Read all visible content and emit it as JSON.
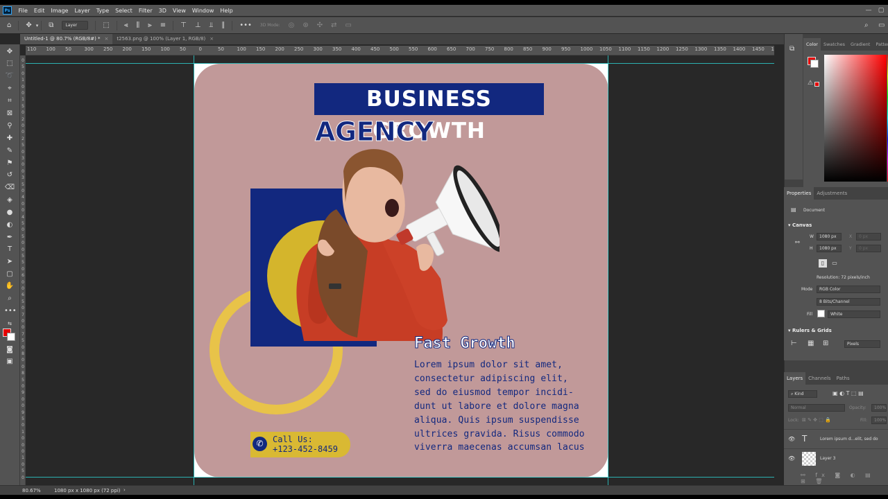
{
  "app": {
    "logo": "Ps"
  },
  "menubar": {
    "items": [
      "File",
      "Edit",
      "Image",
      "Layer",
      "Type",
      "Select",
      "Filter",
      "3D",
      "View",
      "Window",
      "Help"
    ]
  },
  "options_bar": {
    "layer_select": "Layer",
    "mode_3d": "3D Mode:"
  },
  "tabs": [
    {
      "label": "Untitled-1 @ 80.7% (RGB/8#) *",
      "active": true
    },
    {
      "label": "t2563.png @ 100% (Layer 1, RGB/8)",
      "active": false
    }
  ],
  "ruler_top": [
    "110",
    "100",
    "50",
    "300",
    "250",
    "200",
    "150",
    "100",
    "50",
    "0",
    "50",
    "100",
    "150",
    "200",
    "250",
    "300",
    "350",
    "400",
    "450",
    "500",
    "550",
    "600",
    "650",
    "700",
    "750",
    "800",
    "850",
    "900",
    "950",
    "1000",
    "1050",
    "1100",
    "1150",
    "1200",
    "1250",
    "1300",
    "1350",
    "1400",
    "1450",
    "15"
  ],
  "ruler_left": [
    "0",
    "5",
    "0",
    "1",
    "0",
    "0",
    "1",
    "5",
    "0",
    "2",
    "0",
    "0",
    "2",
    "5",
    "0",
    "3",
    "0",
    "0",
    "3",
    "5",
    "0",
    "4",
    "0",
    "0",
    "4",
    "5",
    "0",
    "5",
    "0",
    "0",
    "5",
    "5",
    "0",
    "6",
    "0",
    "0",
    "6",
    "5",
    "0",
    "7",
    "0",
    "0",
    "7",
    "5",
    "0",
    "8",
    "0",
    "0",
    "8",
    "5",
    "0",
    "9",
    "0",
    "0",
    "9",
    "5",
    "0",
    "1",
    "0",
    "0",
    "0",
    "1",
    "0",
    "5",
    "0"
  ],
  "design": {
    "title_line1": "BUSINESS GROWTH",
    "title_line2": "AGENCY",
    "section_title": "Fast Growth",
    "body_lines": [
      "Lorem ipsum dolor sit amet,",
      "consectetur adipiscing elit,",
      "sed do eiusmod tempor incidi-",
      "dunt ut labore et dolore magna",
      "aliqua. Quis ipsum suspendisse",
      "ultrices gravida. Risus commodo",
      "viverra maecenas accumsan lacus"
    ],
    "call_label": "Call Us:",
    "phone": "+123-452-8459",
    "colors": {
      "background": "#c19999",
      "navy": "#12287f",
      "yellow": "#d9b933",
      "ring": "#e8c349"
    }
  },
  "color_panel": {
    "tabs": [
      "Color",
      "Swatches",
      "Gradient",
      "Patterns"
    ],
    "foreground": "#e60000",
    "background": "#ffffff"
  },
  "properties": {
    "tabs": [
      "Properties",
      "Adjustments"
    ],
    "doc_label": "Document",
    "canvas_header": "Canvas",
    "w_label": "W",
    "w_value": "1080 px",
    "h_label": "H",
    "h_value": "1080 px",
    "x_label": "X",
    "x_value": "0 px",
    "y_label": "Y",
    "y_value": "0 px",
    "resolution": "Resolution: 72 pixels/inch",
    "mode_label": "Mode",
    "mode_value": "RGB Color",
    "depth_value": "8 Bits/Channel",
    "fill_label": "Fill",
    "fill_value": "White",
    "rulers_header": "Rulers & Grids",
    "units_value": "Pixels"
  },
  "layers": {
    "tabs": [
      "Layers",
      "Channels",
      "Paths"
    ],
    "kind": "Kind",
    "blend": "Normal",
    "opacity_label": "Opacity:",
    "opacity_value": "100%",
    "lock_label": "Lock:",
    "fill_label": "Fill:",
    "fill_value": "100%",
    "items": [
      {
        "name": "Lorem ipsum d...elit, sed do",
        "type": "T"
      },
      {
        "name": "Layer 3",
        "type": ""
      }
    ]
  },
  "status": {
    "zoom": "80.67%",
    "doc_size": "1080 px x 1080 px (72 ppi)"
  }
}
